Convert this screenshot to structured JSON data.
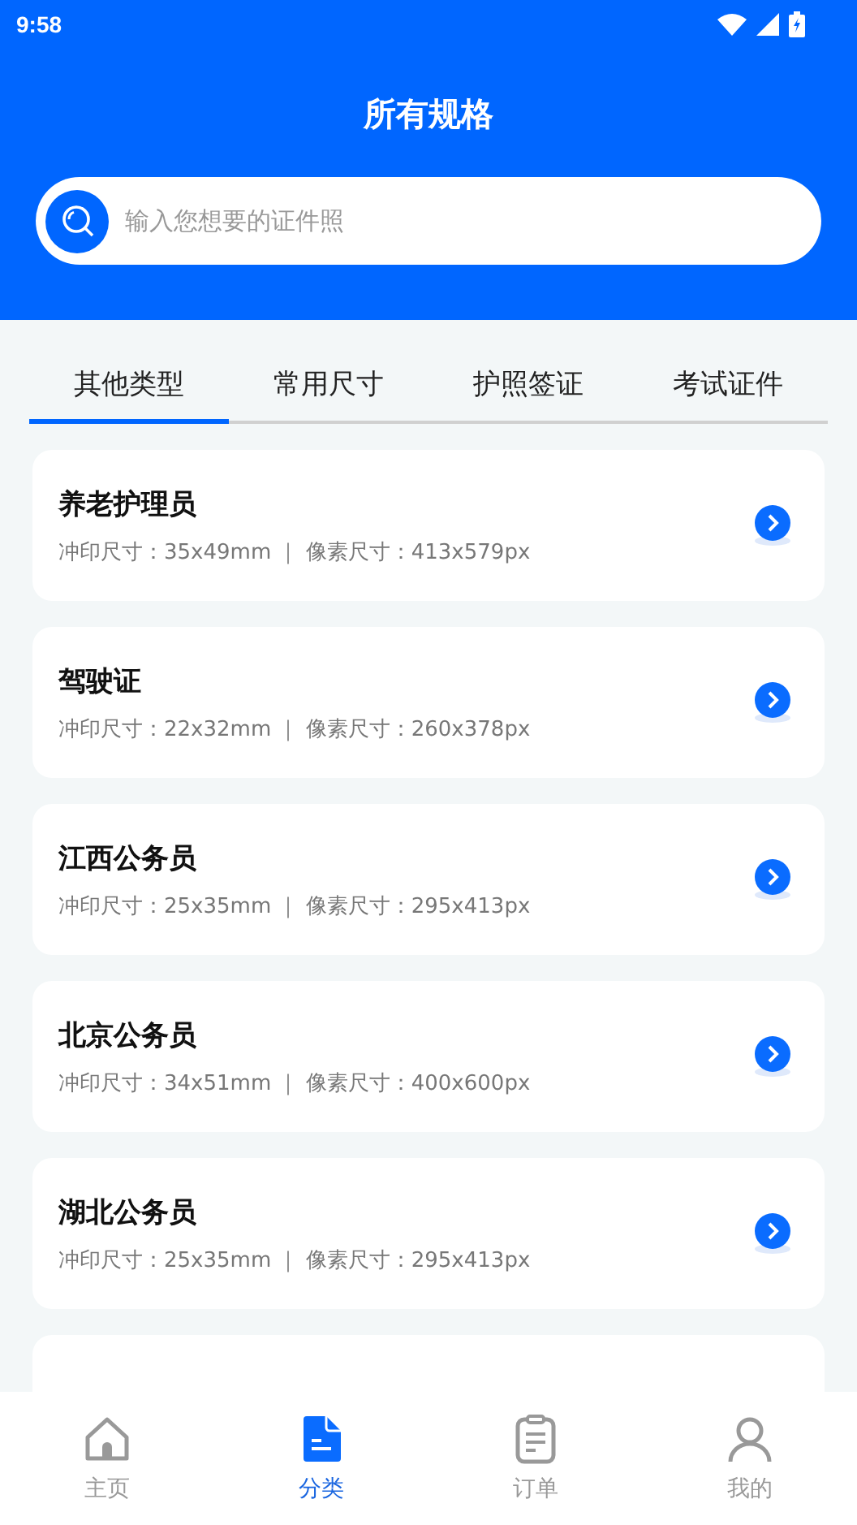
{
  "status_bar": {
    "time": "9:58"
  },
  "header": {
    "title": "所有规格"
  },
  "search": {
    "placeholder": "输入您想要的证件照"
  },
  "tabs": [
    {
      "label": "其他类型",
      "selected": true
    },
    {
      "label": "常用尺寸",
      "selected": false
    },
    {
      "label": "护照签证",
      "selected": false
    },
    {
      "label": "考试证件",
      "selected": false
    }
  ],
  "items": [
    {
      "name": "养老护理员",
      "spec": "冲印尺寸：35x49mm ｜ 像素尺寸：413x579px"
    },
    {
      "name": "驾驶证",
      "spec": "冲印尺寸：22x32mm ｜ 像素尺寸：260x378px"
    },
    {
      "name": "江西公务员",
      "spec": "冲印尺寸：25x35mm ｜ 像素尺寸：295x413px"
    },
    {
      "name": "北京公务员",
      "spec": "冲印尺寸：34x51mm ｜ 像素尺寸：400x600px"
    },
    {
      "name": "湖北公务员",
      "spec": "冲印尺寸：25x35mm ｜ 像素尺寸：295x413px"
    }
  ],
  "bottom_nav": [
    {
      "kind": "home",
      "label": "主页",
      "selected": false
    },
    {
      "kind": "category",
      "label": "分类",
      "selected": true
    },
    {
      "kind": "orders",
      "label": "订单",
      "selected": false
    },
    {
      "kind": "profile",
      "label": "我的",
      "selected": false
    }
  ]
}
